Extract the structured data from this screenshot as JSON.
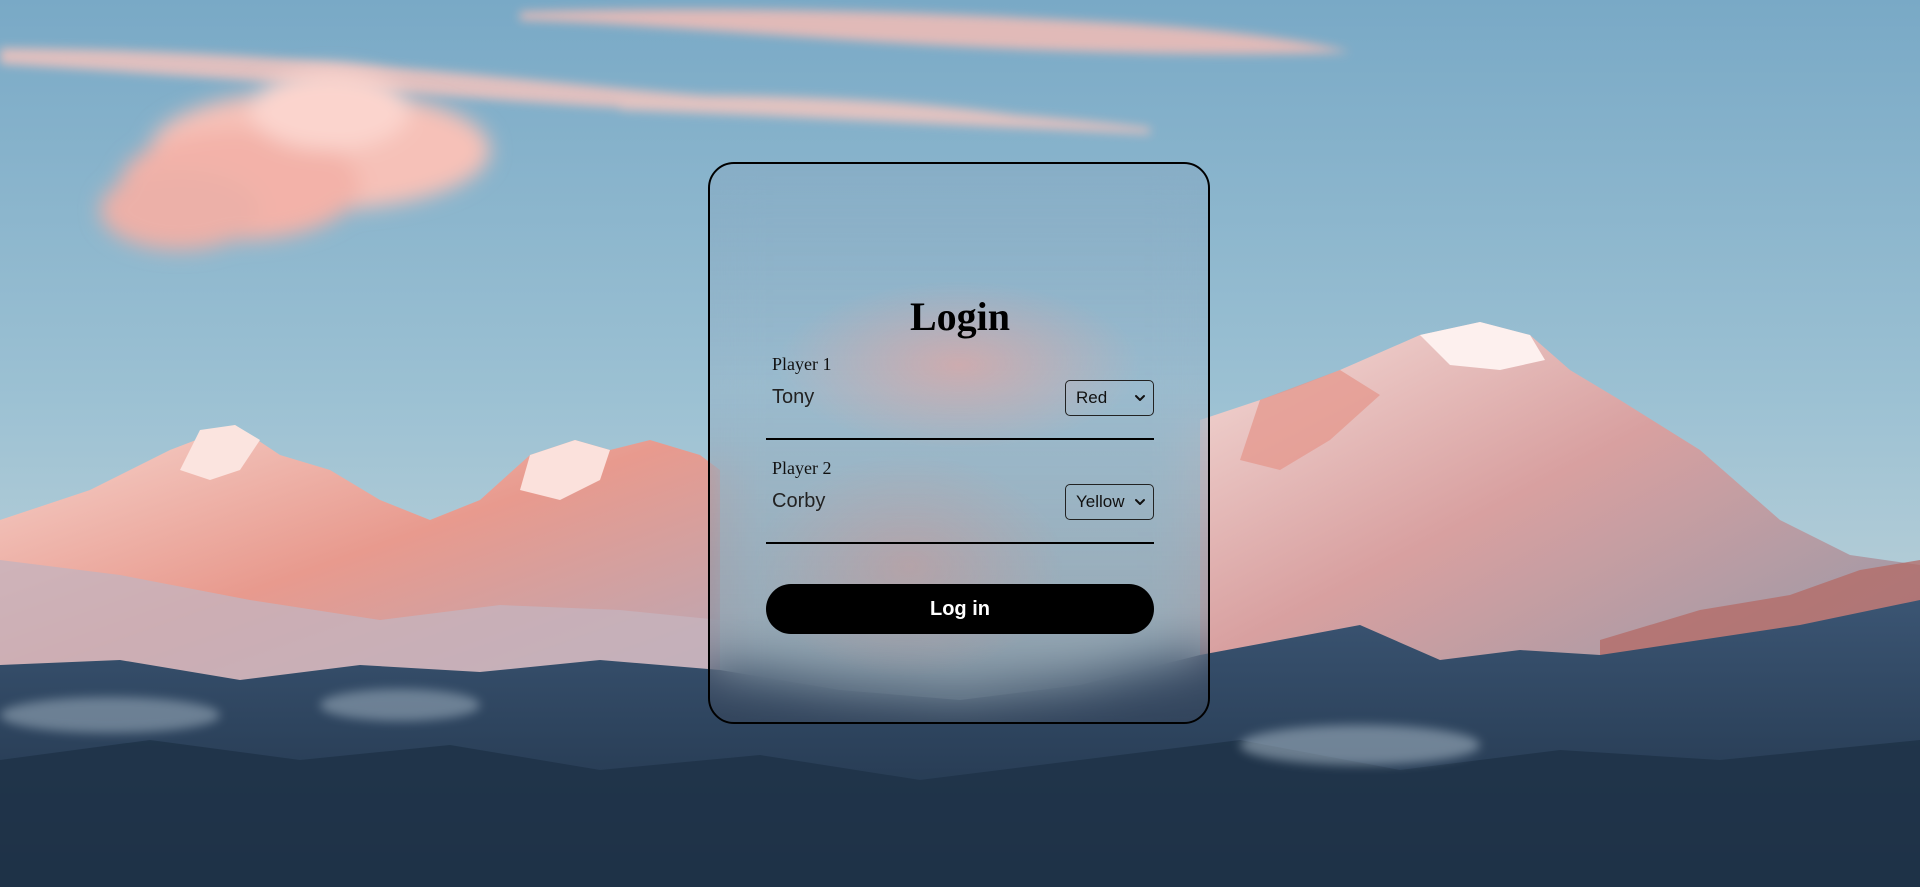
{
  "login": {
    "title": "Login",
    "player1": {
      "label": "Player 1",
      "name_value": "Tony",
      "color_selected": "Red"
    },
    "player2": {
      "label": "Player 2",
      "name_value": "Corby",
      "color_selected": "Yellow"
    },
    "submit_label": "Log in"
  },
  "background": {
    "icon": "mountain-landscape-image",
    "sky_color": "#87b3cc",
    "cloud_color": "#f4b4ad",
    "ridge_color": "#2a4058"
  },
  "icons": {
    "select_chevron": "chevron-down-icon"
  }
}
